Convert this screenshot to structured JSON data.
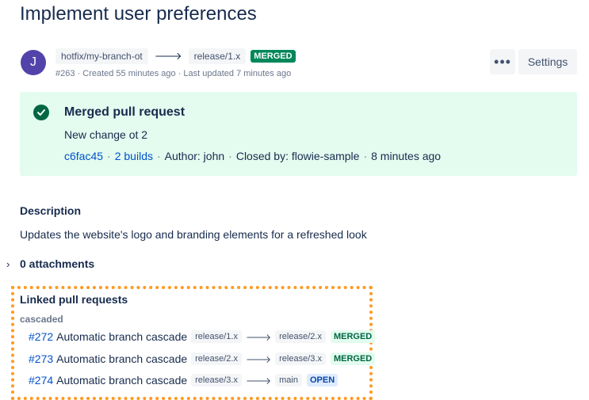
{
  "title": "Implement user preferences",
  "avatar_initial": "J",
  "source_branch": "hotfix/my-branch-ot",
  "arrow": "🡒",
  "target_branch": "release/1.x",
  "status": "MERGED",
  "meta": "#263 · Created 55 minutes ago · Last updated 7 minutes ago",
  "more_label": "•••",
  "settings_label": "Settings",
  "merged_panel": {
    "title": "Merged pull request",
    "subtitle": "New change ot 2",
    "commit": "c6fac45",
    "builds": "2 builds",
    "author": "Author: john",
    "closed_by": "Closed by: flowie-sample",
    "when": "8 minutes ago",
    "separator": "·"
  },
  "description": {
    "heading": "Description",
    "text": "Updates the website's logo and branding elements for a refreshed look"
  },
  "attachments": {
    "chevron": "›",
    "label": "0 attachments"
  },
  "linked": {
    "heading": "Linked pull requests",
    "group": "cascaded",
    "items": [
      {
        "num": "#272",
        "name": "Automatic branch cascade",
        "from": "release/1.x",
        "to": "release/2.x",
        "status": "MERGED"
      },
      {
        "num": "#273",
        "name": "Automatic branch cascade",
        "from": "release/2.x",
        "to": "release/3.x",
        "status": "MERGED"
      },
      {
        "num": "#274",
        "name": "Automatic branch cascade",
        "from": "release/3.x",
        "to": "main",
        "status": "OPEN"
      }
    ]
  },
  "colors": {
    "merged": "#00875a",
    "link": "#0052cc",
    "panel_bg": "#e3fcef",
    "highlight": "#ff991f"
  }
}
